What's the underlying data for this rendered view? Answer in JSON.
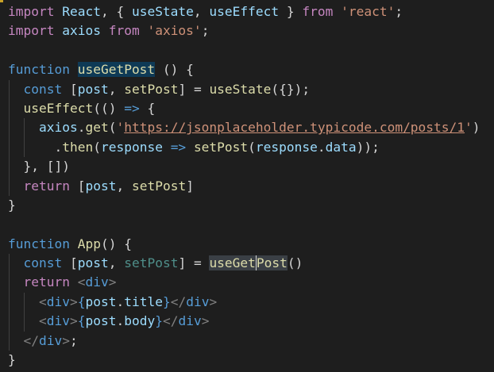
{
  "editor": {
    "lines": [
      [
        [
          "kw",
          "import"
        ],
        [
          "pun",
          " "
        ],
        [
          "var",
          "React"
        ],
        [
          "pun",
          ", { "
        ],
        [
          "var",
          "useState"
        ],
        [
          "pun",
          ", "
        ],
        [
          "var",
          "useEffect"
        ],
        [
          "pun",
          " } "
        ],
        [
          "kw",
          "from"
        ],
        [
          "pun",
          " "
        ],
        [
          "str",
          "'react'"
        ],
        [
          "pun",
          ";"
        ]
      ],
      [
        [
          "kw",
          "import"
        ],
        [
          "pun",
          " "
        ],
        [
          "var",
          "axios"
        ],
        [
          "pun",
          " "
        ],
        [
          "kw",
          "from"
        ],
        [
          "pun",
          " "
        ],
        [
          "str",
          "'axios'"
        ],
        [
          "pun",
          ";"
        ]
      ],
      [],
      [
        [
          "st",
          "function"
        ],
        [
          "pun",
          " "
        ],
        [
          "fn hl1",
          "useGetPost"
        ],
        [
          "pun",
          " () {"
        ]
      ],
      [
        [
          "pun",
          "  "
        ],
        [
          "st",
          "const"
        ],
        [
          "pun",
          " ["
        ],
        [
          "var",
          "post"
        ],
        [
          "pun",
          ", "
        ],
        [
          "fn",
          "setPost"
        ],
        [
          "pun",
          "] = "
        ],
        [
          "fn",
          "useState"
        ],
        [
          "pun",
          "({});"
        ]
      ],
      [
        [
          "pun",
          "  "
        ],
        [
          "fn",
          "useEffect"
        ],
        [
          "pun",
          "(() "
        ],
        [
          "st",
          "=>"
        ],
        [
          "pun",
          " {"
        ]
      ],
      [
        [
          "pun",
          "    "
        ],
        [
          "var",
          "axios"
        ],
        [
          "pun",
          "."
        ],
        [
          "fn",
          "get"
        ],
        [
          "pun",
          "("
        ],
        [
          "str",
          "'"
        ],
        [
          "url",
          "https://jsonplaceholder.typicode.com/posts/1"
        ],
        [
          "str",
          "'"
        ],
        [
          "pun",
          ")"
        ]
      ],
      [
        [
          "pun",
          "      ."
        ],
        [
          "fn",
          "then"
        ],
        [
          "pun",
          "("
        ],
        [
          "var",
          "response"
        ],
        [
          "pun",
          " "
        ],
        [
          "st",
          "=>"
        ],
        [
          "pun",
          " "
        ],
        [
          "fn",
          "setPost"
        ],
        [
          "pun",
          "("
        ],
        [
          "var",
          "response"
        ],
        [
          "pun",
          "."
        ],
        [
          "var",
          "data"
        ],
        [
          "pun",
          "));"
        ]
      ],
      [
        [
          "pun",
          "  }, [])"
        ]
      ],
      [
        [
          "pun",
          "  "
        ],
        [
          "kw",
          "return"
        ],
        [
          "pun",
          " ["
        ],
        [
          "var",
          "post"
        ],
        [
          "pun",
          ", "
        ],
        [
          "fn",
          "setPost"
        ],
        [
          "pun",
          "]"
        ]
      ],
      [
        [
          "pun",
          "}"
        ]
      ],
      [],
      [
        [
          "st",
          "function"
        ],
        [
          "pun",
          " "
        ],
        [
          "fn",
          "App"
        ],
        [
          "pun",
          "() {"
        ]
      ],
      [
        [
          "pun",
          "  "
        ],
        [
          "st",
          "const"
        ],
        [
          "pun",
          " ["
        ],
        [
          "var",
          "post"
        ],
        [
          "pun",
          ", "
        ],
        [
          "dim",
          "setPost"
        ],
        [
          "pun",
          "] = "
        ],
        [
          "fn hl2",
          "useGet"
        ],
        [
          "fn hl2 cursor",
          "Post"
        ],
        [
          "pun",
          "()"
        ]
      ],
      [
        [
          "pun",
          "  "
        ],
        [
          "kw",
          "return"
        ],
        [
          "pun",
          " "
        ],
        [
          "br",
          "<"
        ],
        [
          "tag",
          "div"
        ],
        [
          "br",
          ">"
        ]
      ],
      [
        [
          "pun",
          "    "
        ],
        [
          "br",
          "<"
        ],
        [
          "tag",
          "div"
        ],
        [
          "br",
          ">"
        ],
        [
          "st",
          "{"
        ],
        [
          "var",
          "post"
        ],
        [
          "pun",
          "."
        ],
        [
          "var",
          "title"
        ],
        [
          "st",
          "}"
        ],
        [
          "br",
          "</"
        ],
        [
          "tag",
          "div"
        ],
        [
          "br",
          ">"
        ]
      ],
      [
        [
          "pun",
          "    "
        ],
        [
          "br",
          "<"
        ],
        [
          "tag",
          "div"
        ],
        [
          "br",
          ">"
        ],
        [
          "st",
          "{"
        ],
        [
          "var",
          "post"
        ],
        [
          "pun",
          "."
        ],
        [
          "var",
          "body"
        ],
        [
          "st",
          "}"
        ],
        [
          "br",
          "</"
        ],
        [
          "tag",
          "div"
        ],
        [
          "br",
          ">"
        ]
      ],
      [
        [
          "pun",
          "  "
        ],
        [
          "br",
          "</"
        ],
        [
          "tag",
          "div"
        ],
        [
          "br",
          ">"
        ],
        [
          "pun",
          ";"
        ]
      ],
      [
        [
          "pun",
          "}"
        ]
      ]
    ]
  }
}
